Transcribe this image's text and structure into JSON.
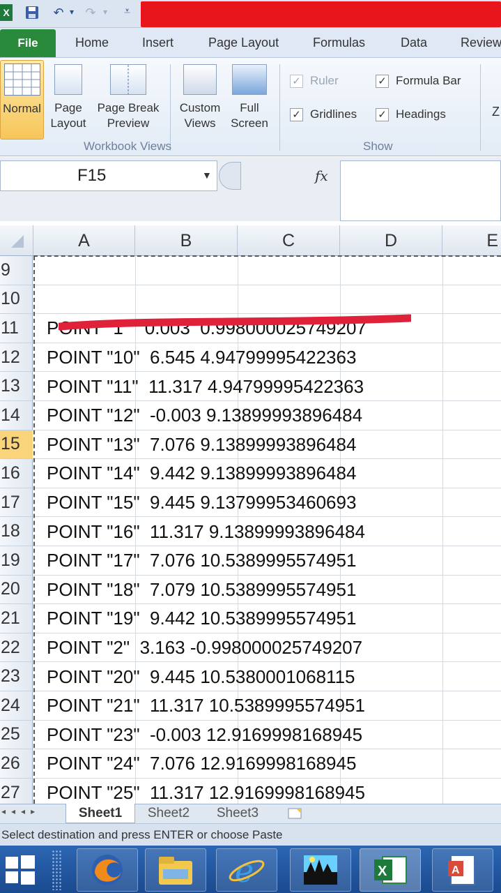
{
  "quick_access": {
    "undo": "↶",
    "redo": "↷"
  },
  "ribbon_tabs": [
    "File",
    "Home",
    "Insert",
    "Page Layout",
    "Formulas",
    "Data",
    "Review"
  ],
  "workbook_views": {
    "group_label": "Workbook Views",
    "normal": "Normal",
    "page_layout": [
      "Page",
      "Layout"
    ],
    "page_break": [
      "Page Break",
      "Preview"
    ],
    "custom_views": [
      "Custom",
      "Views"
    ],
    "full_screen": [
      "Full",
      "Screen"
    ]
  },
  "show": {
    "group_label": "Show",
    "ruler": {
      "label": "Ruler",
      "checked": true,
      "disabled": true
    },
    "formula_bar": {
      "label": "Formula Bar",
      "checked": true
    },
    "gridlines": {
      "label": "Gridlines",
      "checked": true
    },
    "headings": {
      "label": "Headings",
      "checked": true
    },
    "zoom_partial": "Z"
  },
  "formula_bar": {
    "name_box": "F15",
    "fx": "fx",
    "value": ""
  },
  "columns": [
    "A",
    "B",
    "C",
    "D",
    "E"
  ],
  "rows": [
    {
      "num": "9",
      "text": ""
    },
    {
      "num": "10",
      "text": ""
    },
    {
      "num": "11",
      "text": "POINT \"1\"   0.003  0.998000025749207"
    },
    {
      "num": "12",
      "text": "POINT \"10\"  6.545 4.94799995422363"
    },
    {
      "num": "13",
      "text": "POINT \"11\"  11.317 4.94799995422363"
    },
    {
      "num": "14",
      "text": "POINT \"12\"  -0.003 9.13899993896484"
    },
    {
      "num": "15",
      "text": "POINT \"13\"  7.076 9.13899993896484"
    },
    {
      "num": "16",
      "text": "POINT \"14\"  9.442 9.13899993896484"
    },
    {
      "num": "17",
      "text": "POINT \"15\"  9.445 9.13799953460693"
    },
    {
      "num": "18",
      "text": "POINT \"16\"  11.317 9.13899993896484"
    },
    {
      "num": "19",
      "text": "POINT \"17\"  7.076 10.5389995574951"
    },
    {
      "num": "20",
      "text": "POINT \"18\"  7.079 10.5389995574951"
    },
    {
      "num": "21",
      "text": "POINT \"19\"  9.442 10.5389995574951"
    },
    {
      "num": "22",
      "text": "POINT \"2\"  3.163 -0.998000025749207"
    },
    {
      "num": "23",
      "text": "POINT \"20\"  9.445 10.5380001068115"
    },
    {
      "num": "24",
      "text": "POINT \"21\"  11.317 10.5389995574951"
    },
    {
      "num": "25",
      "text": "POINT \"23\"  -0.003 12.9169998168945"
    },
    {
      "num": "26",
      "text": "POINT \"24\"  7.076 12.9169998168945"
    },
    {
      "num": "27",
      "text": "POINT \"25\"  11.317 12.9169998168945"
    }
  ],
  "active_row": "15",
  "sheets": [
    "Sheet1",
    "Sheet2",
    "Sheet3"
  ],
  "active_sheet": "Sheet1",
  "status_text": "Select destination and press ENTER or choose Paste",
  "colors": {
    "file_tab": "#2a8a3c",
    "redaction": "#e8161c",
    "scribble": "#e0213a",
    "active_row": "#f9d47a",
    "taskbar": "#1f56a0"
  },
  "taskbar_icons": [
    "windows-start-icon",
    "firefox-icon",
    "file-explorer-icon",
    "internet-explorer-icon",
    "image-viewer-icon",
    "excel-icon",
    "word-icon"
  ]
}
